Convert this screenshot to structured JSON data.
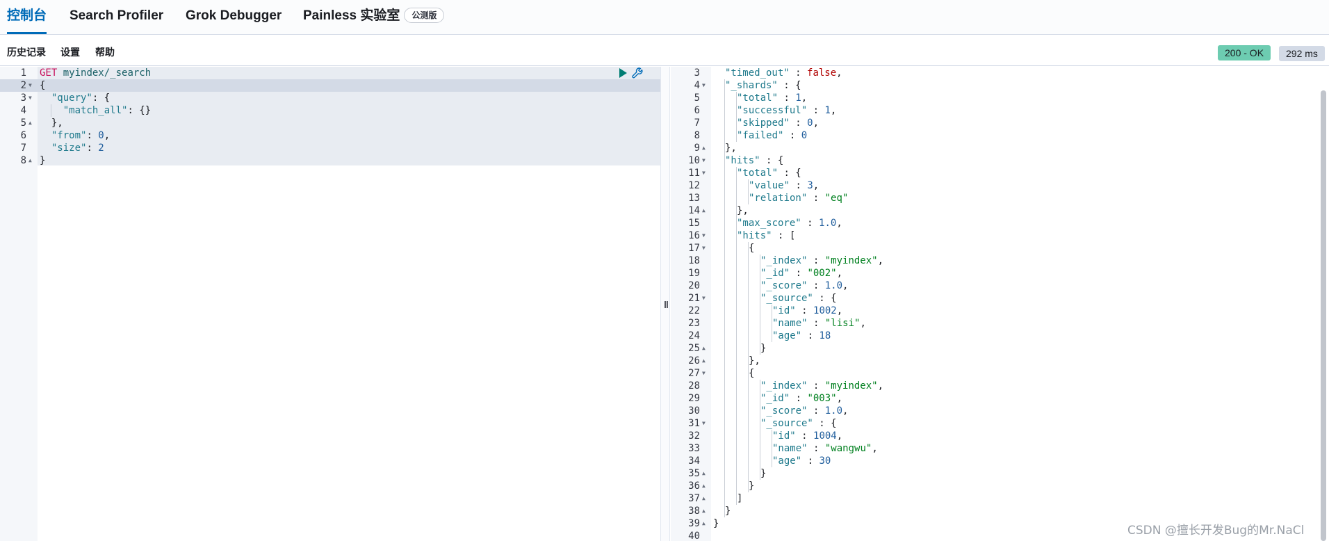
{
  "tabs": [
    {
      "label": "控制台",
      "active": true
    },
    {
      "label": "Search Profiler",
      "active": false
    },
    {
      "label": "Grok Debugger",
      "active": false
    },
    {
      "label": "Painless 实验室",
      "active": false,
      "badge": "公测版"
    }
  ],
  "toolbar": {
    "history": "历史记录",
    "settings": "设置",
    "help": "帮助",
    "status": "200 - OK",
    "took": "292 ms"
  },
  "request": {
    "method": "GET",
    "path": "myindex/_search",
    "body_lines": [
      "{",
      "  \"query\": {",
      "    \"match_all\": {}",
      "  },",
      "  \"from\": 0,",
      "  \"size\": 2",
      "}"
    ]
  },
  "response": {
    "first_line": 3,
    "last_line": 40,
    "timed_out": "false",
    "shards": {
      "total": "1",
      "successful": "1",
      "skipped": "0",
      "failed": "0"
    },
    "hits_total": {
      "value": "3",
      "relation": "\"eq\""
    },
    "max_score": "1.0",
    "hits": [
      {
        "index": "\"myindex\"",
        "id": "\"002\"",
        "score": "1.0",
        "source": {
          "id": "1002",
          "name": "\"lisi\"",
          "age": "18"
        }
      },
      {
        "index": "\"myindex\"",
        "id": "\"003\"",
        "score": "1.0",
        "source": {
          "id": "1004",
          "name": "\"wangwu\"",
          "age": "30"
        }
      }
    ]
  },
  "watermark": "CSDN @擅长开发Bug的Mr.NaCl",
  "colors": {
    "accent": "#006bb8",
    "ok_badge": "#6dccb1",
    "method": "#c80f5b",
    "string": "#00801f"
  }
}
